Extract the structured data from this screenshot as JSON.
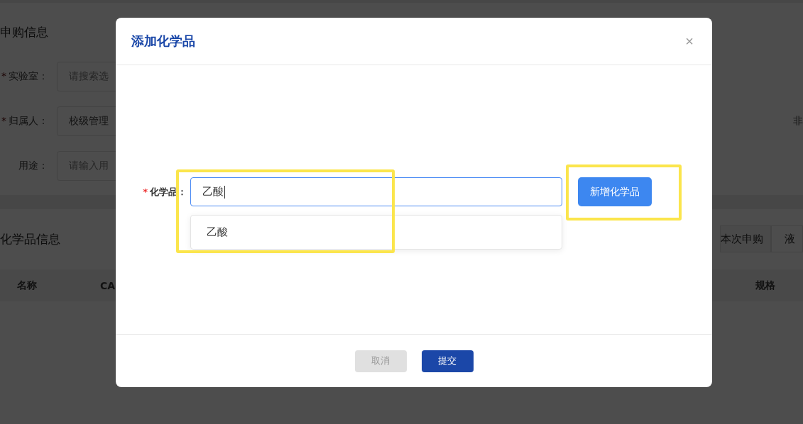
{
  "page": {
    "sections": [
      {
        "title": "申购信息",
        "fields": [
          {
            "label": "实验室：",
            "required_mark": "*",
            "placeholder": "请搜索选"
          },
          {
            "label": "归属人：",
            "required_mark": "*",
            "value": "校级管理"
          },
          {
            "label": "用途：",
            "placeholder": "请输入用"
          }
        ],
        "side_text": "非"
      },
      {
        "title": "化学品信息",
        "tabs": [
          {
            "label": "本次申购"
          },
          {
            "label": "液"
          }
        ],
        "table": {
          "columns": [
            {
              "label": "名称"
            },
            {
              "label": "CA"
            },
            {
              "label": "规格"
            }
          ]
        }
      }
    ]
  },
  "modal": {
    "title": "添加化学品",
    "close": "×",
    "field": {
      "label": "化学品：",
      "required_mark": "*",
      "value": "乙酸",
      "suggestions": [
        "乙酸"
      ],
      "highlighted": true
    },
    "add_button": {
      "label": "新增化学品",
      "highlighted": true
    },
    "buttons": [
      {
        "label": "取消",
        "kind": "secondary",
        "disabled": true
      },
      {
        "label": "提交",
        "kind": "primary",
        "disabled": false
      }
    ]
  }
}
